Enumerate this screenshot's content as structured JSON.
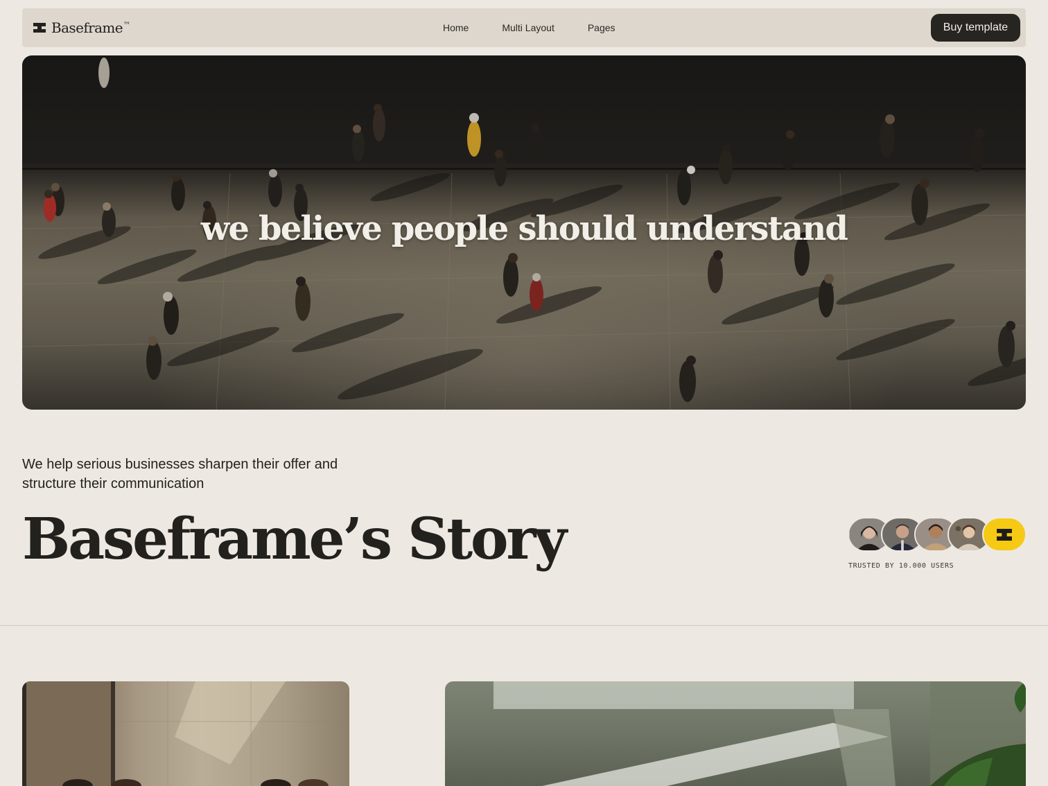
{
  "nav": {
    "brand": "Baseframe",
    "brand_mark": "™",
    "links": [
      {
        "label": "Home"
      },
      {
        "label": "Multi Layout"
      },
      {
        "label": "Pages"
      }
    ],
    "cta_label": "Buy template"
  },
  "hero": {
    "headline": "we believe people should understand"
  },
  "intro": {
    "tagline": "We help serious businesses sharpen their offer and structure their communication",
    "title": "Baseframe’s Story"
  },
  "trust": {
    "label": "TRUSTED BY 10.000 USERS",
    "badge_icon": "baseframe-logo-icon"
  },
  "colors": {
    "background": "#ede9e2",
    "nav_background": "#ddd7cd",
    "button": "#272522",
    "badge": "#f6c915"
  }
}
